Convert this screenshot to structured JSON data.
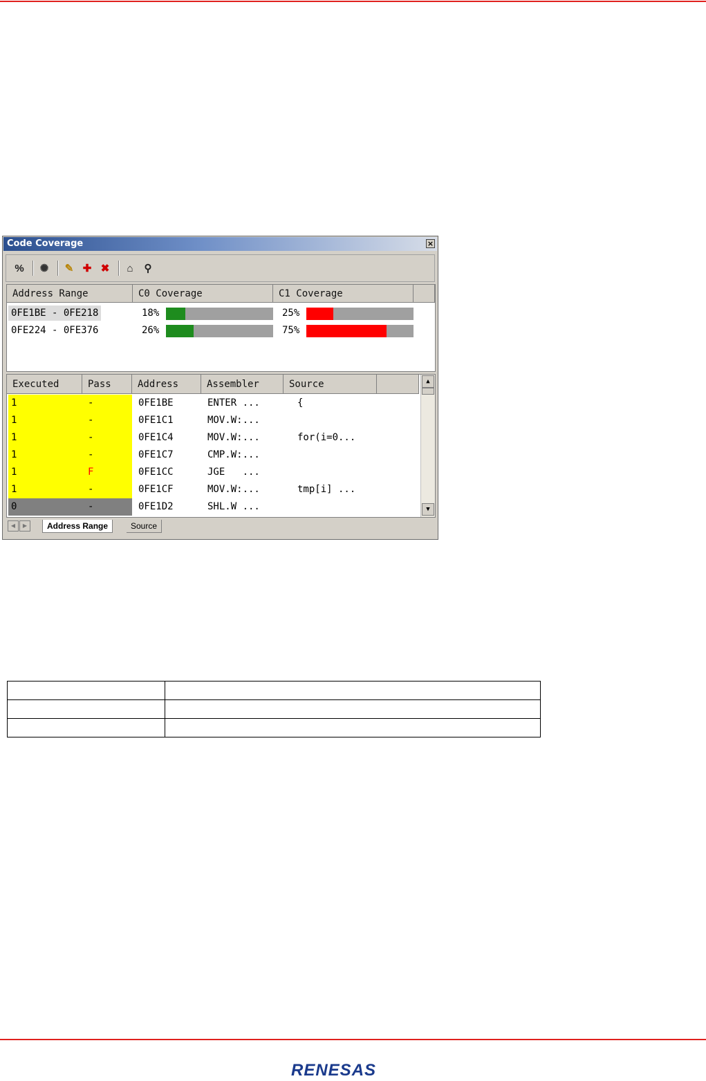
{
  "window": {
    "title": "Code Coverage",
    "close_glyph": "×"
  },
  "toolbar": {
    "buttons": [
      {
        "name": "percent-icon",
        "glyph": "%"
      },
      {
        "name": "radar-icon",
        "glyph": "✺"
      },
      {
        "name": "edit-range-icon",
        "glyph": "✎"
      },
      {
        "name": "add-range-icon",
        "glyph": "✚"
      },
      {
        "name": "delete-range-icon",
        "glyph": "✖"
      },
      {
        "name": "save-icon",
        "glyph": "⌂"
      },
      {
        "name": "find-icon",
        "glyph": "⚲"
      }
    ]
  },
  "upper": {
    "headers": [
      "Address Range",
      "C0 Coverage",
      "C1 Coverage"
    ],
    "rows": [
      {
        "range": "0FE1BE - 0FE218",
        "c0_pct": "18%",
        "c0_value": 18,
        "c1_pct": "25%",
        "c1_value": 25,
        "selected": true
      },
      {
        "range": "0FE224 - 0FE376",
        "c0_pct": "26%",
        "c0_value": 26,
        "c1_pct": "75%",
        "c1_value": 75,
        "selected": false
      }
    ],
    "colors": {
      "c0": "#1e8c1e",
      "c1": "#ff0000",
      "track": "#a0a0a0"
    }
  },
  "lower": {
    "headers": [
      "Executed",
      "Pass",
      "Address",
      "Assembler",
      "Source"
    ],
    "rows": [
      {
        "executed": "1",
        "pass": "-",
        "address": "0FE1BE",
        "assembler": "ENTER ...",
        "source": "{"
      },
      {
        "executed": "1",
        "pass": "-",
        "address": "0FE1C1",
        "assembler": "MOV.W:...",
        "source": ""
      },
      {
        "executed": "1",
        "pass": "-",
        "address": "0FE1C4",
        "assembler": "MOV.W:...",
        "source": "for(i=0..."
      },
      {
        "executed": "1",
        "pass": "-",
        "address": "0FE1C7",
        "assembler": "CMP.W:...",
        "source": ""
      },
      {
        "executed": "1",
        "pass": "F",
        "address": "0FE1CC",
        "assembler": "JGE   ...",
        "source": ""
      },
      {
        "executed": "1",
        "pass": "-",
        "address": "0FE1CF",
        "assembler": "MOV.W:...",
        "source": "tmp[i] ..."
      },
      {
        "executed": "0",
        "pass": "-",
        "address": "0FE1D2",
        "assembler": "SHL.W ...",
        "source": ""
      }
    ],
    "colors": {
      "executed_bg": "#ffff00",
      "not_executed_bg": "#808080",
      "fail_fg": "#ff0000"
    }
  },
  "tabs": [
    {
      "label": "Address Range",
      "active": true
    },
    {
      "label": "Source",
      "active": false
    }
  ],
  "footer": {
    "logo_text": "RENESAS",
    "logo_color": "#1a3a8c"
  },
  "accent": "#e0201e"
}
